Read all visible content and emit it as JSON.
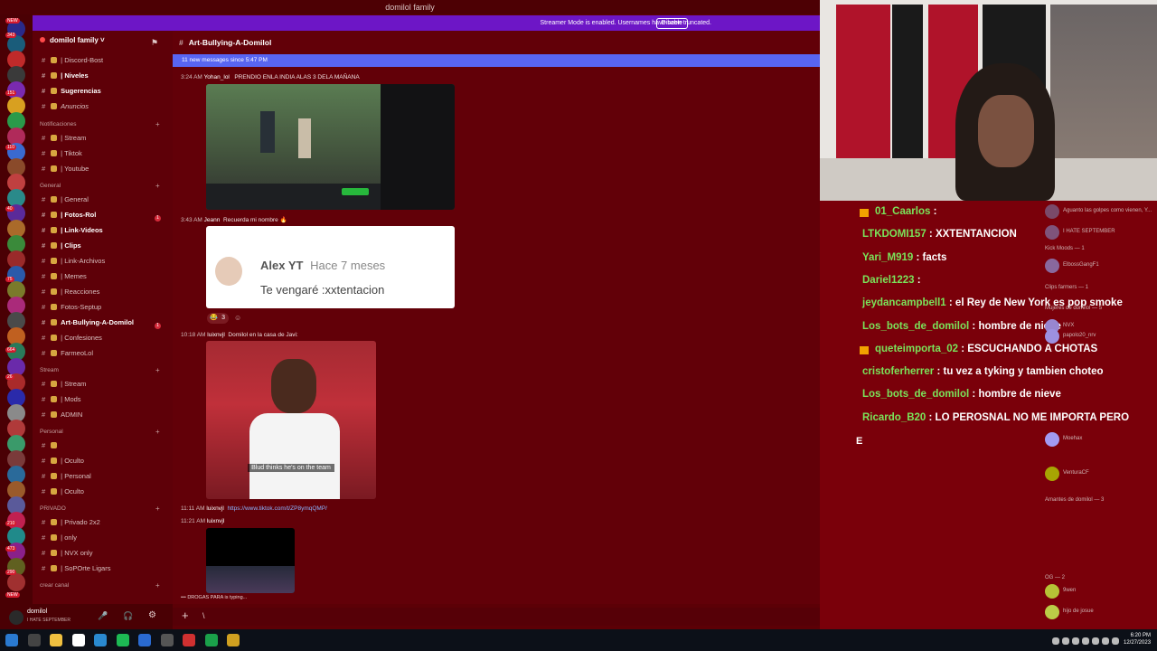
{
  "window": {
    "title": "domilol family"
  },
  "streamer_mode": {
    "message": "Streamer Mode is enabled. Usernames have been truncated.",
    "disable_label": "Disable"
  },
  "rail": {
    "badges": [
      "NEW",
      "343",
      "151",
      "110",
      "40",
      "75",
      "664",
      "26",
      "210",
      "473",
      "290",
      "NEW"
    ]
  },
  "guild": {
    "name": "domilol family"
  },
  "sidebar": {
    "channels_top": [
      {
        "label": "| Discord-Bost",
        "bold": false,
        "italic": false
      },
      {
        "label": "| Niveles",
        "bold": true,
        "italic": false
      },
      {
        "label": "Sugerencias",
        "bold": true,
        "italic": false
      },
      {
        "label": "Anuncios",
        "bold": false,
        "italic": true
      }
    ],
    "categories": [
      {
        "name": "Notificaciones",
        "items": [
          "| Stream",
          "| Tiktok",
          "| Youtube"
        ]
      },
      {
        "name": "General",
        "items": [
          "| General",
          "| Fotos-Rol",
          "| Link-Videos",
          "| Clips",
          "| Link-Archivos",
          "| Memes",
          "| Reacciones",
          "Fotos-Septup",
          "Art-Bullying-A-Domilol",
          "| Confesiones",
          "FarmeoLol"
        ]
      },
      {
        "name": "Stream",
        "items": [
          "| Stream",
          "| Mods",
          "ADMIN"
        ]
      },
      {
        "name": "Personal",
        "items": [
          "",
          "| Oculto",
          "| Personal",
          "| Oculto"
        ]
      },
      {
        "name": "PRIVADO",
        "items": [
          "| Privado 2x2",
          "| only",
          "| NVX only",
          "| SoPOrte Ligars"
        ]
      },
      {
        "name": "crear canal",
        "items": []
      }
    ],
    "unread_counts": [
      "1",
      "1"
    ]
  },
  "user_panel": {
    "name": "domilol",
    "status": "I HATE SEPTEMBER"
  },
  "chat": {
    "channel": "Art-Bullying-A-Domilol",
    "new_messages": "11 new messages since 5:47 PM",
    "messages": [
      {
        "time": "3:24 AM",
        "author": "Yohan_lol",
        "text": "PRENDIO ENLA INDIA ALAS 3 DELA MAÑANA"
      },
      {
        "time": "3:43 AM",
        "author": "Jeann",
        "text": "Recuerda mi nombre"
      },
      {
        "time": "10:18 AM",
        "author": "luixnvjl",
        "text": "Domilol en la casa de Javi:"
      },
      {
        "time": "11:11 AM",
        "author": "luixnvjl",
        "text": "https://www.tiktok.com/t/ZP8ymqQMP/"
      },
      {
        "time": "11:21 AM",
        "author": "luixnvjl",
        "text": ""
      }
    ],
    "comment_card": {
      "name": "Alex YT",
      "ago": "Hace 7 meses",
      "text": "Te vengaré :xxtentacion"
    },
    "reaction_count": "3",
    "video_caption": "Blud thinks he's on the team",
    "typing": "DROGAS PARA is typing...",
    "composer_glyph": "\\"
  },
  "stream_chat": [
    {
      "user": "01_Caarlos",
      "text": "",
      "crown": true
    },
    {
      "user": "LTKDOMI157",
      "text": "XXTENTANCION",
      "crown": false
    },
    {
      "user": "Yari_M919",
      "text": "facts",
      "crown": false
    },
    {
      "user": "Dariel1223",
      "text": "",
      "crown": false
    },
    {
      "user": "jeydancampbell1",
      "text": "el Rey de New York es pop smoke",
      "crown": false
    },
    {
      "user": "Los_bots_de_domilol",
      "text": "hombre de nieve",
      "crown": false
    },
    {
      "user": "queteimporta_02",
      "text": "ESCUCHANDO A CHOTAS",
      "crown": true
    },
    {
      "user": "cristoferherrer",
      "text": "tu vez a tyking y tambien choteo",
      "crown": false
    },
    {
      "user": "Los_bots_de_domilol",
      "text": "hombre de nieve",
      "crown": false
    },
    {
      "user": "Ricardo_B20",
      "text": "LO PEROSNAL NO ME IMPORTA PERO",
      "crown": false
    }
  ],
  "stream_chat_input": "E",
  "members": {
    "lines": [
      "Aguanto las golpes como vienen, Y...",
      "I HATE SEPTEMBER",
      "Kick Moods — 1",
      "ElbossGangF1",
      "Clips farmers — 1",
      "Mujeres de domilol — 5",
      "NVX",
      "papolo20_nrv",
      "Moehax",
      "VenturaCF",
      "Amantes de domilol — 3",
      "OG — 2",
      "9wen",
      "hijo de josue"
    ]
  },
  "taskbar": {
    "time": "6:20 PM",
    "date": "12/27/2023"
  }
}
